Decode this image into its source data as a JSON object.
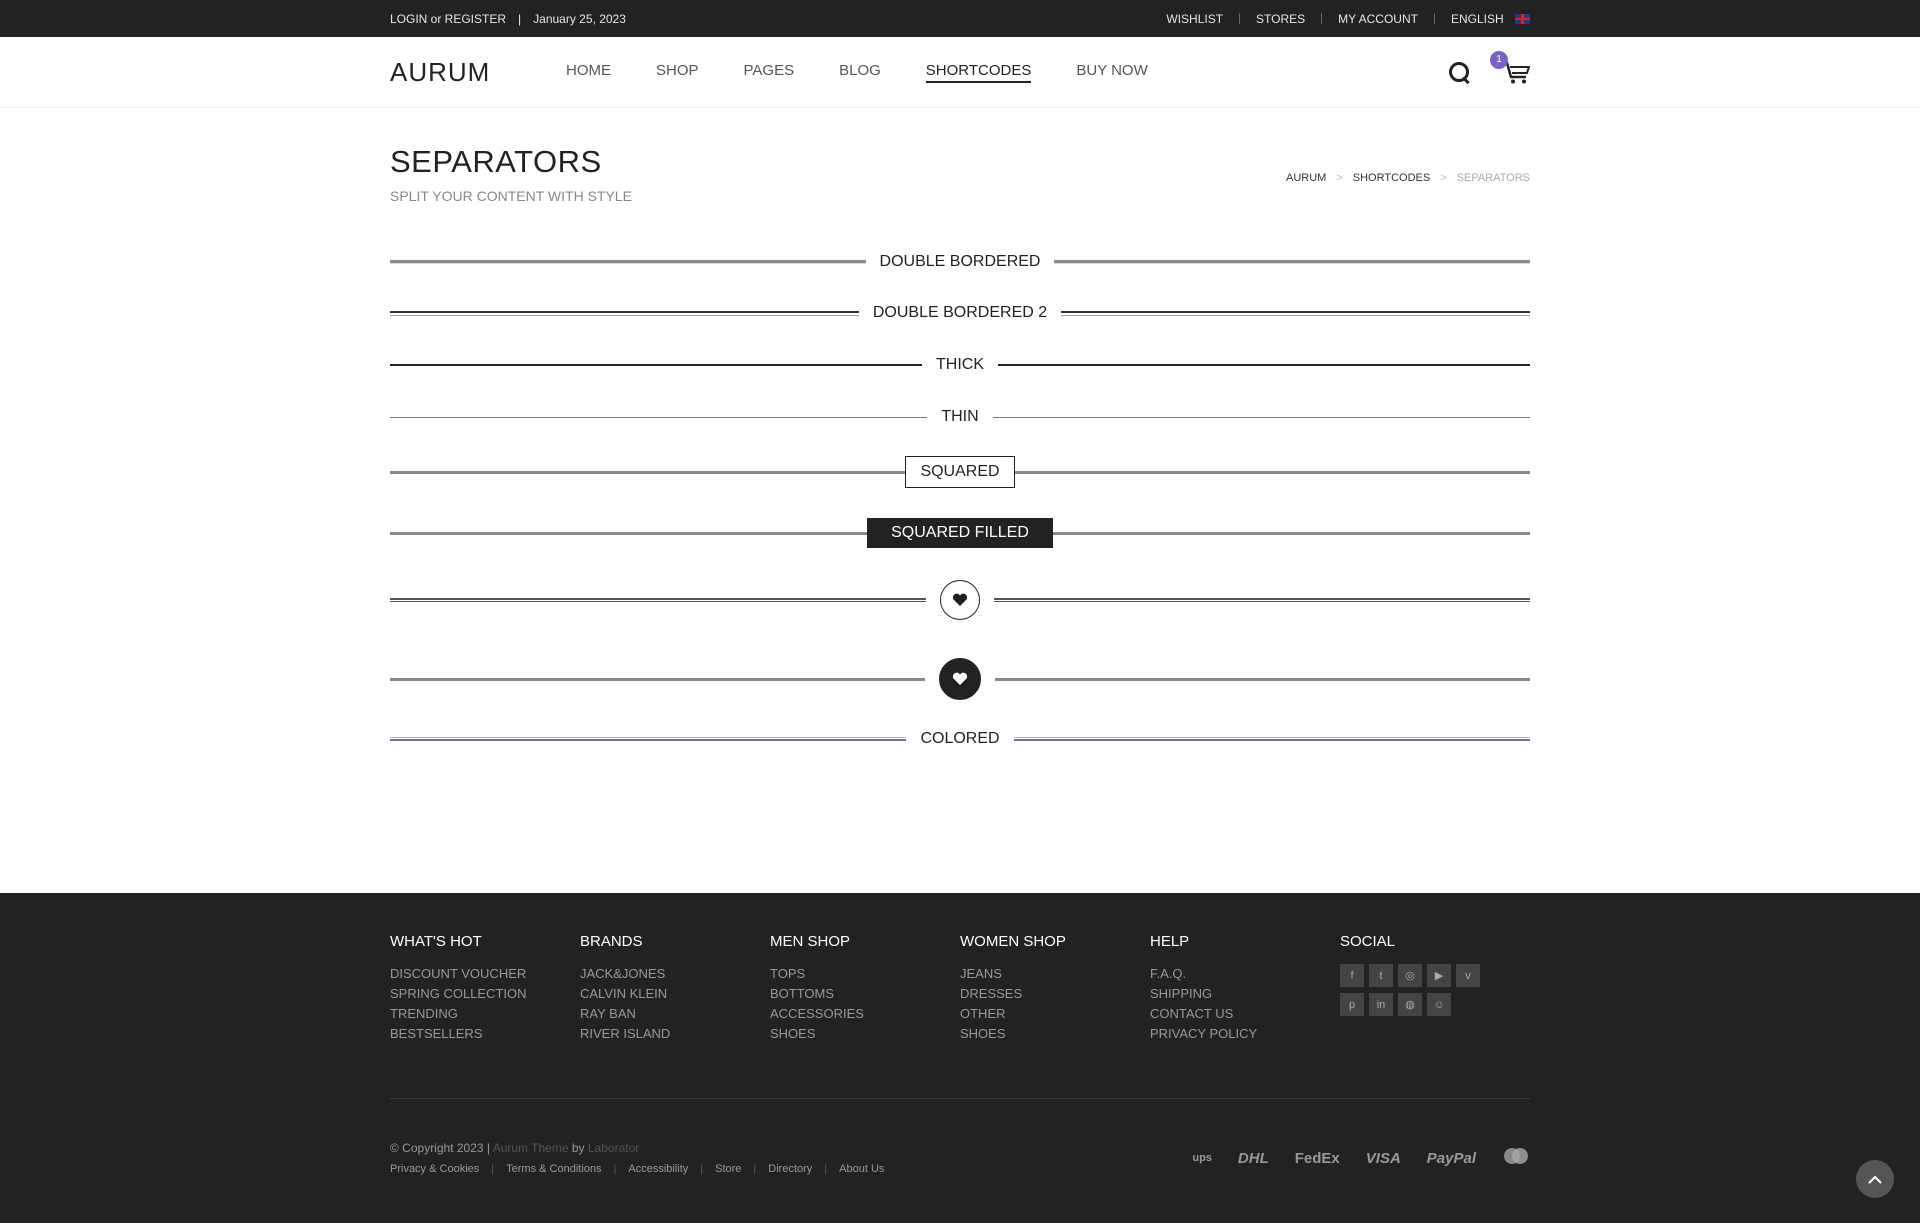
{
  "topbar": {
    "login": "LOGIN or REGISTER",
    "date": "January 25, 2023",
    "links": [
      "WISHLIST",
      "STORES",
      "MY ACCOUNT"
    ],
    "language": "ENGLISH"
  },
  "header": {
    "logo": "AURUM",
    "nav": [
      "HOME",
      "SHOP",
      "PAGES",
      "BLOG",
      "SHORTCODES",
      "BUY NOW"
    ],
    "active_nav": "SHORTCODES",
    "cart_count": "1"
  },
  "title": {
    "heading": "SEPARATORS",
    "subtitle": "SPLIT YOUR CONTENT WITH STYLE",
    "breadcrumb": [
      "AURUM",
      "SHORTCODES",
      "SEPARATORS"
    ]
  },
  "separators": {
    "double_bordered": "DOUBLE BORDERED",
    "double_bordered_2": "DOUBLE BORDERED 2",
    "thick": "THICK",
    "thin": "THIN",
    "squared": "SQUARED",
    "squared_filled": "SQUARED FILLED",
    "colored": "COLORED"
  },
  "colors": {
    "accent": "#7c61c4",
    "dark": "#222222"
  },
  "footer": {
    "columns": [
      {
        "title": "WHAT'S HOT",
        "items": [
          "DISCOUNT VOUCHER",
          "SPRING COLLECTION",
          "TRENDING",
          "BESTSELLERS"
        ]
      },
      {
        "title": "BRANDS",
        "items": [
          "JACK&JONES",
          "CALVIN KLEIN",
          "RAY BAN",
          "RIVER ISLAND"
        ]
      },
      {
        "title": "MEN SHOP",
        "items": [
          "TOPS",
          "BOTTOMS",
          "ACCESSORIES",
          "SHOES"
        ]
      },
      {
        "title": "WOMEN SHOP",
        "items": [
          "JEANS",
          "DRESSES",
          "OTHER",
          "SHOES"
        ]
      },
      {
        "title": "HELP",
        "items": [
          "F.A.Q.",
          "SHIPPING",
          "CONTACT US",
          "PRIVACY POLICY"
        ]
      }
    ],
    "social_title": "SOCIAL",
    "social_icons": [
      "facebook-icon",
      "twitter-icon",
      "instagram-icon",
      "youtube-icon",
      "vimeo-icon",
      "pinterest-icon",
      "linkedin-icon",
      "dribbble-icon",
      "snapchat-icon"
    ],
    "copyright_prefix": "© Copyright 2023 |",
    "theme_name": "Aurum Theme",
    "by": "by",
    "author": "Laborator",
    "links": [
      "Privacy & Cookies",
      "Terms & Conditions",
      "Accessibility",
      "Store",
      "Directory",
      "About Us"
    ],
    "payments": [
      "ups",
      "DHL",
      "FedEx",
      "VISA",
      "PayPal",
      "mastercard"
    ]
  }
}
